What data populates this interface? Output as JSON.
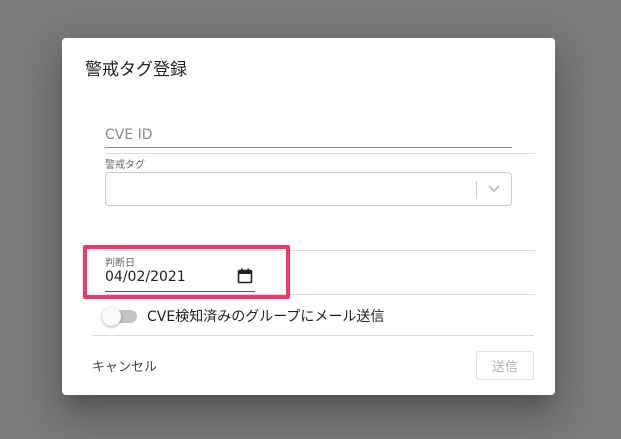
{
  "dialog": {
    "title": "警戒タグ登録",
    "cve_id": {
      "placeholder": "CVE ID",
      "value": ""
    },
    "alert_tag": {
      "label": "警戒タグ",
      "selected": ""
    },
    "judgment_date": {
      "label": "判断日",
      "value": "04/02/2021"
    },
    "notify_toggle": {
      "label": "CVE検知済みのグループにメール送信",
      "checked": false
    },
    "cancel_label": "キャンセル",
    "submit_label": "送信"
  },
  "colors": {
    "highlight": "#f2386b",
    "backdrop": "#7b7b7b"
  }
}
